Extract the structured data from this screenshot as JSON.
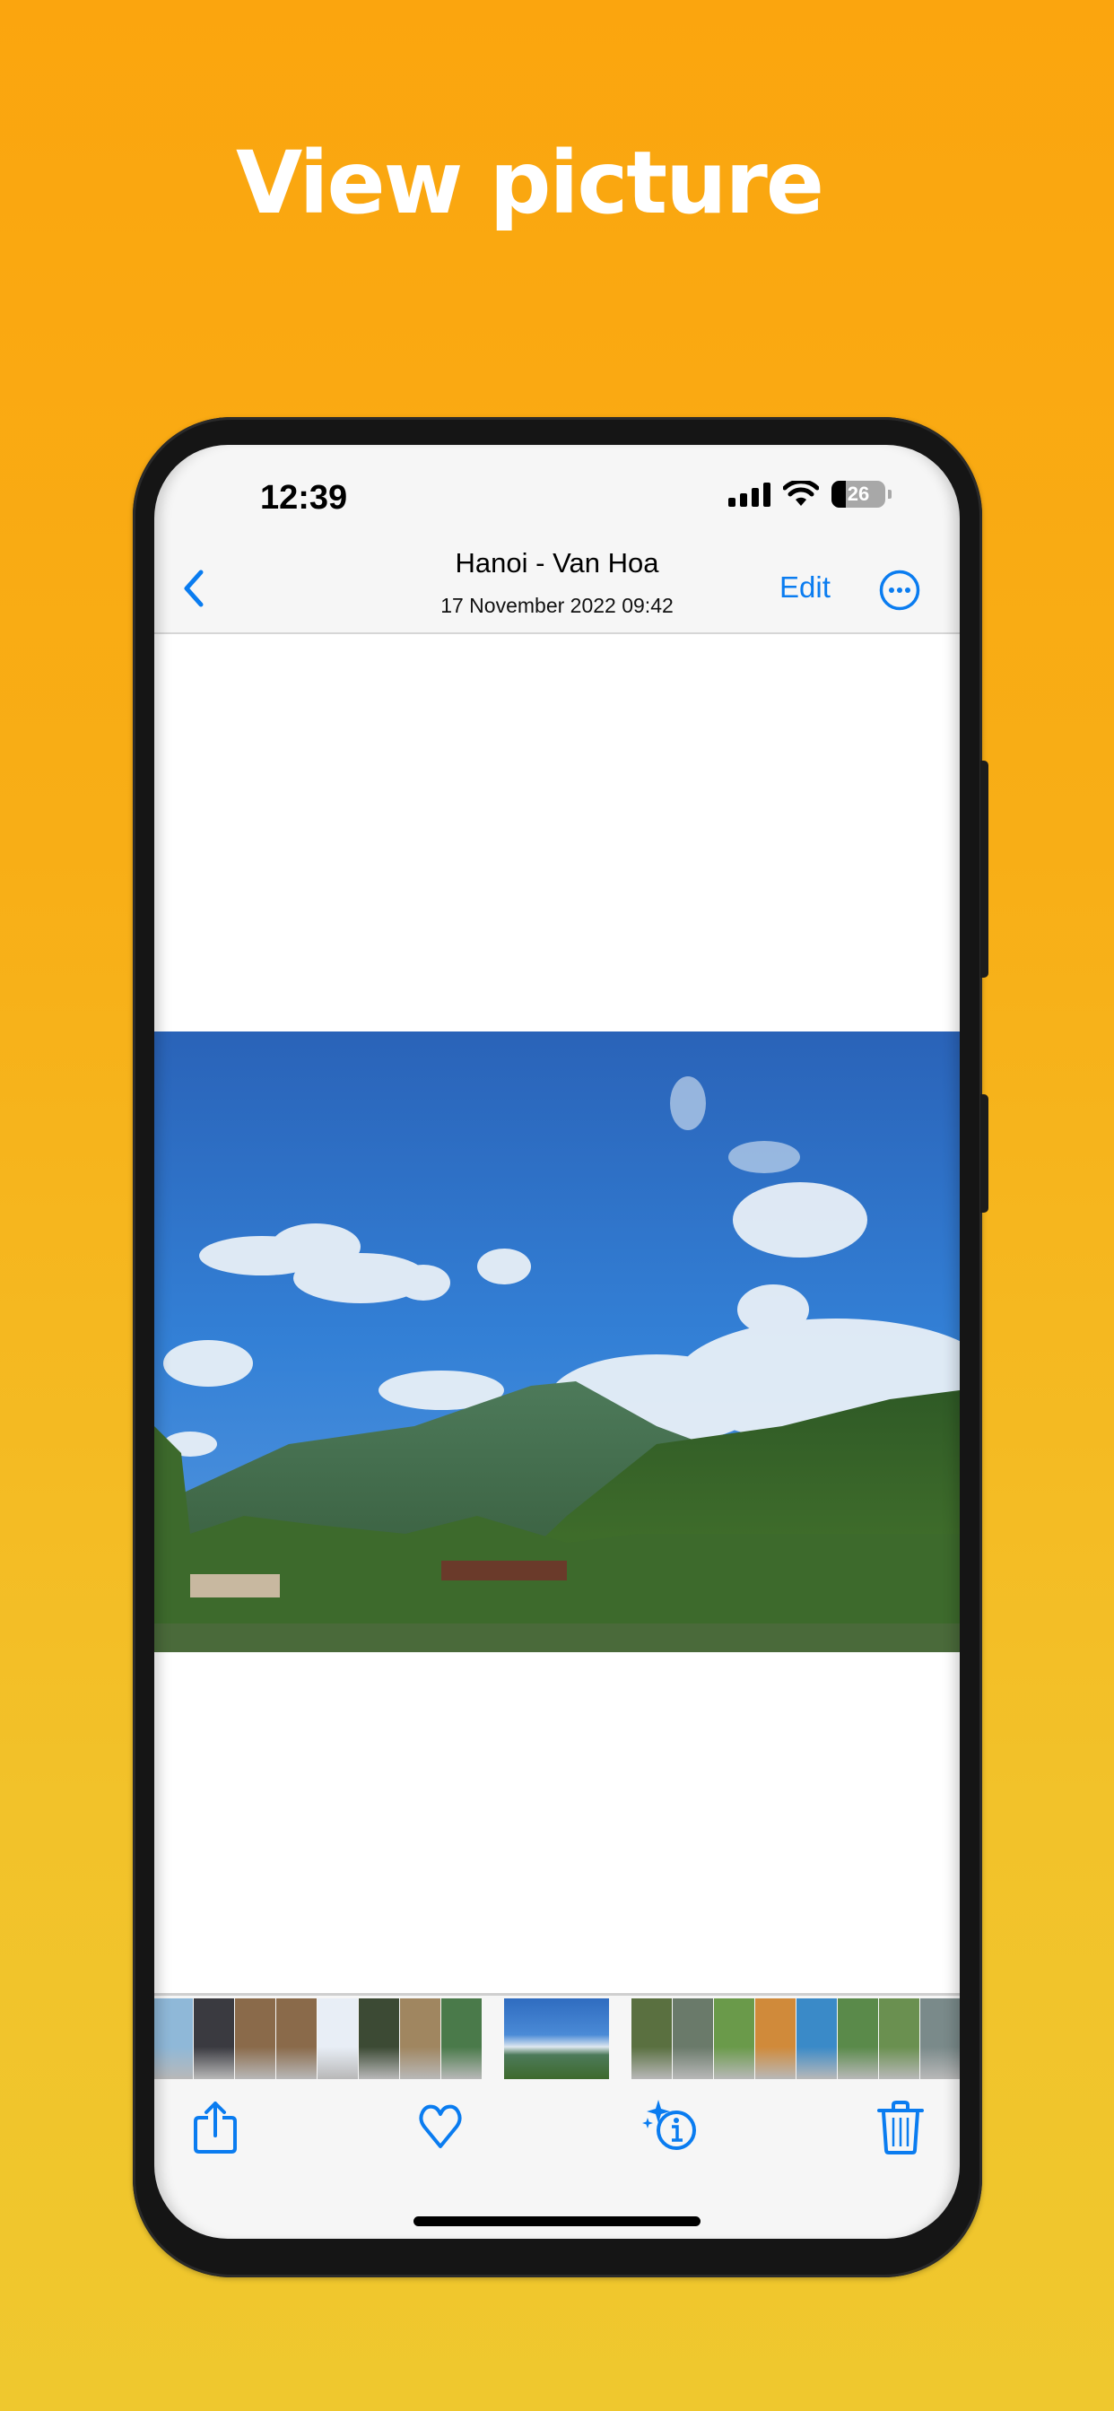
{
  "page": {
    "headline": "View picture",
    "colors": {
      "background_top": "#FBA50E",
      "background_bottom": "#EFC82E",
      "accent": "#0A7CF0",
      "phone_frame": "#151515"
    }
  },
  "status_bar": {
    "time": "12:39",
    "battery_level": "26",
    "battery_fraction": 0.26,
    "signal_bars": 4,
    "icons": [
      "signal-icon",
      "wifi-icon",
      "battery-icon"
    ]
  },
  "nav_bar": {
    "back_icon": "chevron-left-icon",
    "title": "Hanoi - Van Hoa",
    "subtitle": "17 November 2022  09:42",
    "edit_label": "Edit",
    "more_icon": "ellipsis-circle-icon"
  },
  "photo": {
    "description": "Mountain landscape under blue sky with clouds, forested hills and buildings in the foreground"
  },
  "thumbnail_strip": {
    "selected_index": 8,
    "thumbnails": [
      {
        "subject": "waterfront skyline",
        "color": "#8fb8d8"
      },
      {
        "subject": "night street",
        "color": "#3a3a40"
      },
      {
        "subject": "stage with red podium",
        "color": "#8a6a4a"
      },
      {
        "subject": "stage with red podium",
        "color": "#8a6a4a"
      },
      {
        "subject": "app screenshot",
        "color": "#e8eef6"
      },
      {
        "subject": "sports field at night",
        "color": "#3c4a34"
      },
      {
        "subject": "shelf with products",
        "color": "#a08660"
      },
      {
        "subject": "group under blue sky",
        "color": "#4a7a4a"
      },
      {
        "subject": "mountain landscape",
        "color": "#3f79c8"
      },
      {
        "subject": "forest path",
        "color": "#5a7040"
      },
      {
        "subject": "railing and hills",
        "color": "#6a7a6a"
      },
      {
        "subject": "two people in green vests",
        "color": "#6a9a4a"
      },
      {
        "subject": "group photo with banner",
        "color": "#d08a3a"
      },
      {
        "subject": "man in blue shirt",
        "color": "#3a8ac8"
      },
      {
        "subject": "group in green vests",
        "color": "#5a8a4a"
      },
      {
        "subject": "group outdoors",
        "color": "#6a9050"
      },
      {
        "subject": "building and garden",
        "color": "#7a8a8a"
      }
    ]
  },
  "toolbar": {
    "items": [
      {
        "name": "share-button",
        "icon": "share-icon"
      },
      {
        "name": "favorite-button",
        "icon": "heart-icon"
      },
      {
        "name": "info-button",
        "icon": "sparkle-info-icon"
      },
      {
        "name": "delete-button",
        "icon": "trash-icon"
      }
    ]
  }
}
